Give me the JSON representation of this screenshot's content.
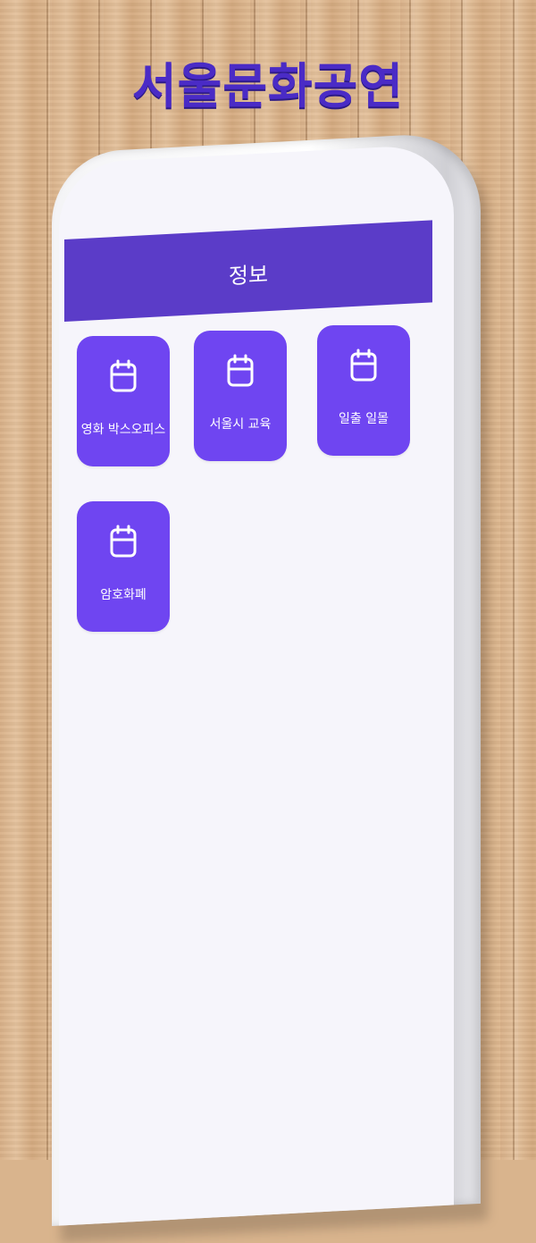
{
  "promo_title": "서울문화공연",
  "app_bar": {
    "title": "정보"
  },
  "menu": [
    {
      "label": "영화 박스오피스",
      "icon": "calendar-icon"
    },
    {
      "label": "서울시 교육",
      "icon": "calendar-icon"
    },
    {
      "label": "일출 일몰",
      "icon": "calendar-icon"
    },
    {
      "label": "암호화폐",
      "icon": "calendar-icon"
    }
  ],
  "colors": {
    "accent": "#5b3cc8",
    "tile": "#6f45f1",
    "title": "#4a2bc6",
    "screen_background": "#f6f5fb"
  }
}
